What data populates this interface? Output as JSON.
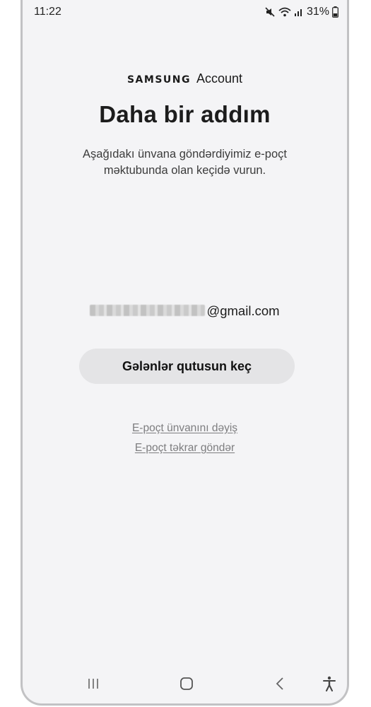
{
  "status_bar": {
    "time": "11:22",
    "battery": "31%",
    "icons": [
      "mute-icon",
      "wifi-icon",
      "signal-icon",
      "battery-icon"
    ]
  },
  "brand": {
    "samsung": "SAMSUNG",
    "account": "Account"
  },
  "title": "Daha bir addım",
  "description": "Aşağıdakı ünvana göndərdiyimiz e-poçt məktubunda olan keçidə vurun.",
  "email": {
    "visible_part": "@gmail.com"
  },
  "buttons": {
    "inbox": "Gələnlər qutusun keç"
  },
  "links": {
    "change_email": "E-poçt ünvanını dəyiş",
    "resend_email": "E-poçt təkrar göndər"
  },
  "nav_bar": {
    "icons": [
      "recents-icon",
      "home-icon",
      "back-icon",
      "accessibility-icon"
    ]
  }
}
